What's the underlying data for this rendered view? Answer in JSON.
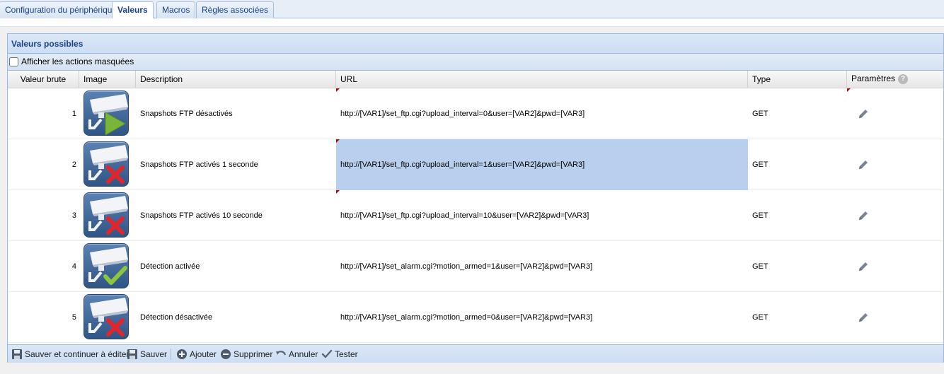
{
  "tabs": [
    {
      "label": "Configuration du périphérique"
    },
    {
      "label": "Valeurs"
    },
    {
      "label": "Macros"
    },
    {
      "label": "Règles associées"
    }
  ],
  "panel": {
    "title": "Valeurs possibles",
    "show_hidden_label": "Afficher les actions masquées",
    "show_hidden_checked": false
  },
  "columns": {
    "raw_value": "Valeur brute",
    "image": "Image",
    "description": "Description",
    "url": "URL",
    "type": "Type",
    "params": "Paramètres"
  },
  "rows": [
    {
      "value": "1",
      "icon": "camera-play-icon",
      "description": "Snapshots FTP désactivés",
      "url": "http://[VAR1]/set_ftp.cgi?upload_interval=0&user=[VAR2]&pwd=[VAR3]",
      "type": "GET"
    },
    {
      "value": "2",
      "icon": "camera-cross-icon",
      "description": "Snapshots FTP activés 1 seconde",
      "url": "http://[VAR1]/set_ftp.cgi?upload_interval=1&user=[VAR2]&pwd=[VAR3]",
      "type": "GET"
    },
    {
      "value": "3",
      "icon": "camera-cross-icon",
      "description": "Snapshots FTP activés 10 seconde",
      "url": "http://[VAR1]/set_ftp.cgi?upload_interval=10&user=[VAR2]&pwd=[VAR3]",
      "type": "GET"
    },
    {
      "value": "4",
      "icon": "camera-check-icon",
      "description": "Détection activée",
      "url": "http://[VAR1]/set_alarm.cgi?motion_armed=1&user=[VAR2]&pwd=[VAR3]",
      "type": "GET"
    },
    {
      "value": "5",
      "icon": "camera-cross-icon",
      "description": "Détection désactivée",
      "url": "http://[VAR1]/set_alarm.cgi?motion_armed=0&user=[VAR2]&pwd=[VAR3]",
      "type": "GET"
    }
  ],
  "toolbar": {
    "save_continue": "Sauver et continuer à éditer",
    "save": "Sauver",
    "add": "Ajouter",
    "delete": "Supprimer",
    "cancel": "Annuler",
    "test": "Tester"
  },
  "colors": {
    "header_text": "#15428b",
    "border": "#99bbe8",
    "selection": "#b9cfee",
    "icon_play": "#7ab43a",
    "icon_cross": "#e0262b",
    "icon_check": "#8cc63f"
  }
}
